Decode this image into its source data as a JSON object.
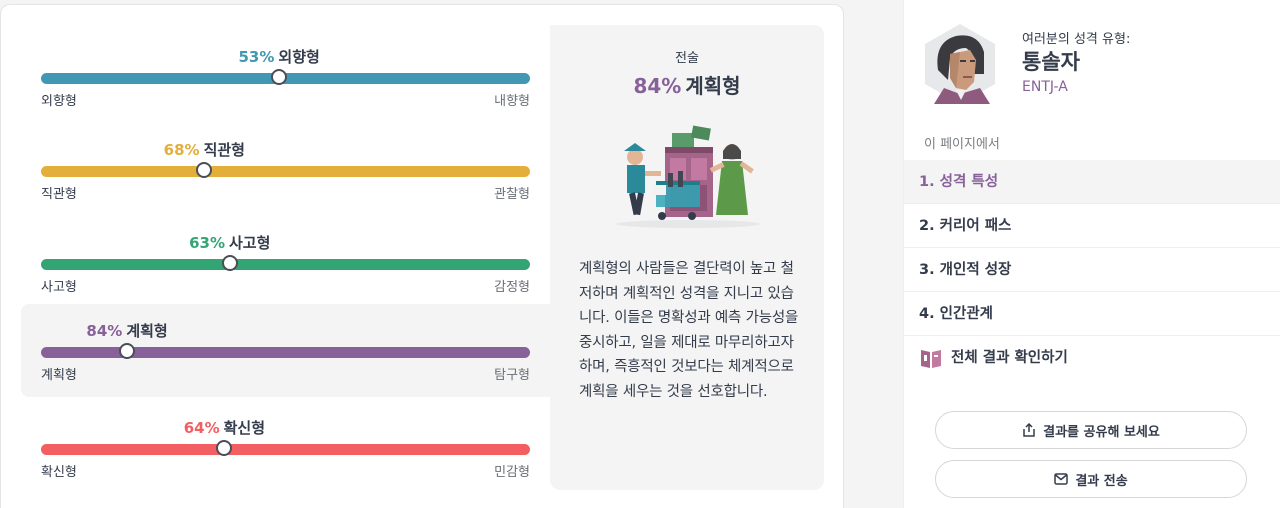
{
  "traits": [
    {
      "percent": "53%",
      "name": "외향형",
      "left": "외향형",
      "right": "내향형",
      "color": "#4298b4",
      "position": 0.487
    },
    {
      "percent": "68%",
      "name": "직관형",
      "left": "직관형",
      "right": "관찰형",
      "color": "#e4ae3a",
      "position": 0.334
    },
    {
      "percent": "63%",
      "name": "사고형",
      "left": "사고형",
      "right": "감정형",
      "color": "#33a474",
      "position": 0.386
    },
    {
      "percent": "84%",
      "name": "계획형",
      "left": "계획형",
      "right": "탐구형",
      "color": "#88619a",
      "position": 0.176,
      "active": true
    },
    {
      "percent": "64%",
      "name": "확신형",
      "left": "확신형",
      "right": "민감형",
      "color": "#f25e62",
      "position": 0.375
    }
  ],
  "description": {
    "subtitle": "전술",
    "percent": "84%",
    "trait": "계획형",
    "illustration": "shopping-cart-traders-illustration",
    "text": "계획형의 사람들은 결단력이 높고 철저하며 계획적인 성격을 지니고 있습니다. 이들은 명확성과 예측 가능성을 중시하고, 일을 제대로 마무리하고자 하며, 즉흥적인 것보다는 체계적으로 계획을 세우는 것을 선호합니다."
  },
  "sidebar": {
    "type_label": "여러분의 성격 유형:",
    "type_name": "통솔자",
    "type_code": "ENTJ-A",
    "avatar": "commander-avatar",
    "on_this_page": "이 페이지에서",
    "nav": [
      {
        "label": "1. 성격 특성",
        "active": true
      },
      {
        "label": "2. 커리어 패스"
      },
      {
        "label": "3. 개인적 성장"
      },
      {
        "label": "4. 인간관계"
      }
    ],
    "all_results": "전체 결과 확인하기",
    "all_results_icon": "book-icon",
    "share_button": "결과를 공유해 보세요",
    "share_icon": "share-icon",
    "send_button": "결과 전송",
    "send_icon": "mail-icon"
  }
}
